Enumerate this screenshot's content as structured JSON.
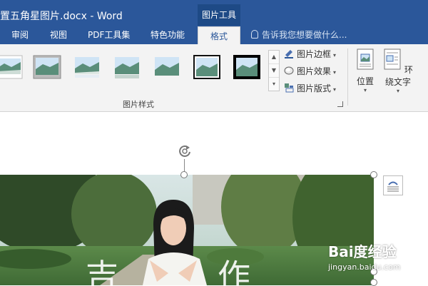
{
  "title_bar": {
    "document_title": "置五角星图片.docx - Word",
    "context_tool": "图片工具",
    "accent_color": "#2b579a"
  },
  "tabs": [
    {
      "label": "审阅"
    },
    {
      "label": "视图"
    },
    {
      "label": "PDF工具集"
    },
    {
      "label": "特色功能"
    },
    {
      "label": "格式",
      "active": true
    }
  ],
  "tell_me": {
    "placeholder": "告诉我您想要做什么..."
  },
  "ribbon": {
    "picture_styles": {
      "group_label": "图片样式",
      "gallery_count": 7,
      "commands": [
        {
          "label": "图片边框",
          "icon": "picture-border-icon"
        },
        {
          "label": "图片效果",
          "icon": "picture-effects-icon"
        },
        {
          "label": "图片版式",
          "icon": "picture-layout-icon"
        }
      ]
    },
    "arrange": {
      "position_label": "位置",
      "wrap_text_label": "环绕文字"
    }
  },
  "watermark": {
    "brand": "Bai度经验",
    "url": "jingyan.baidu.com"
  }
}
